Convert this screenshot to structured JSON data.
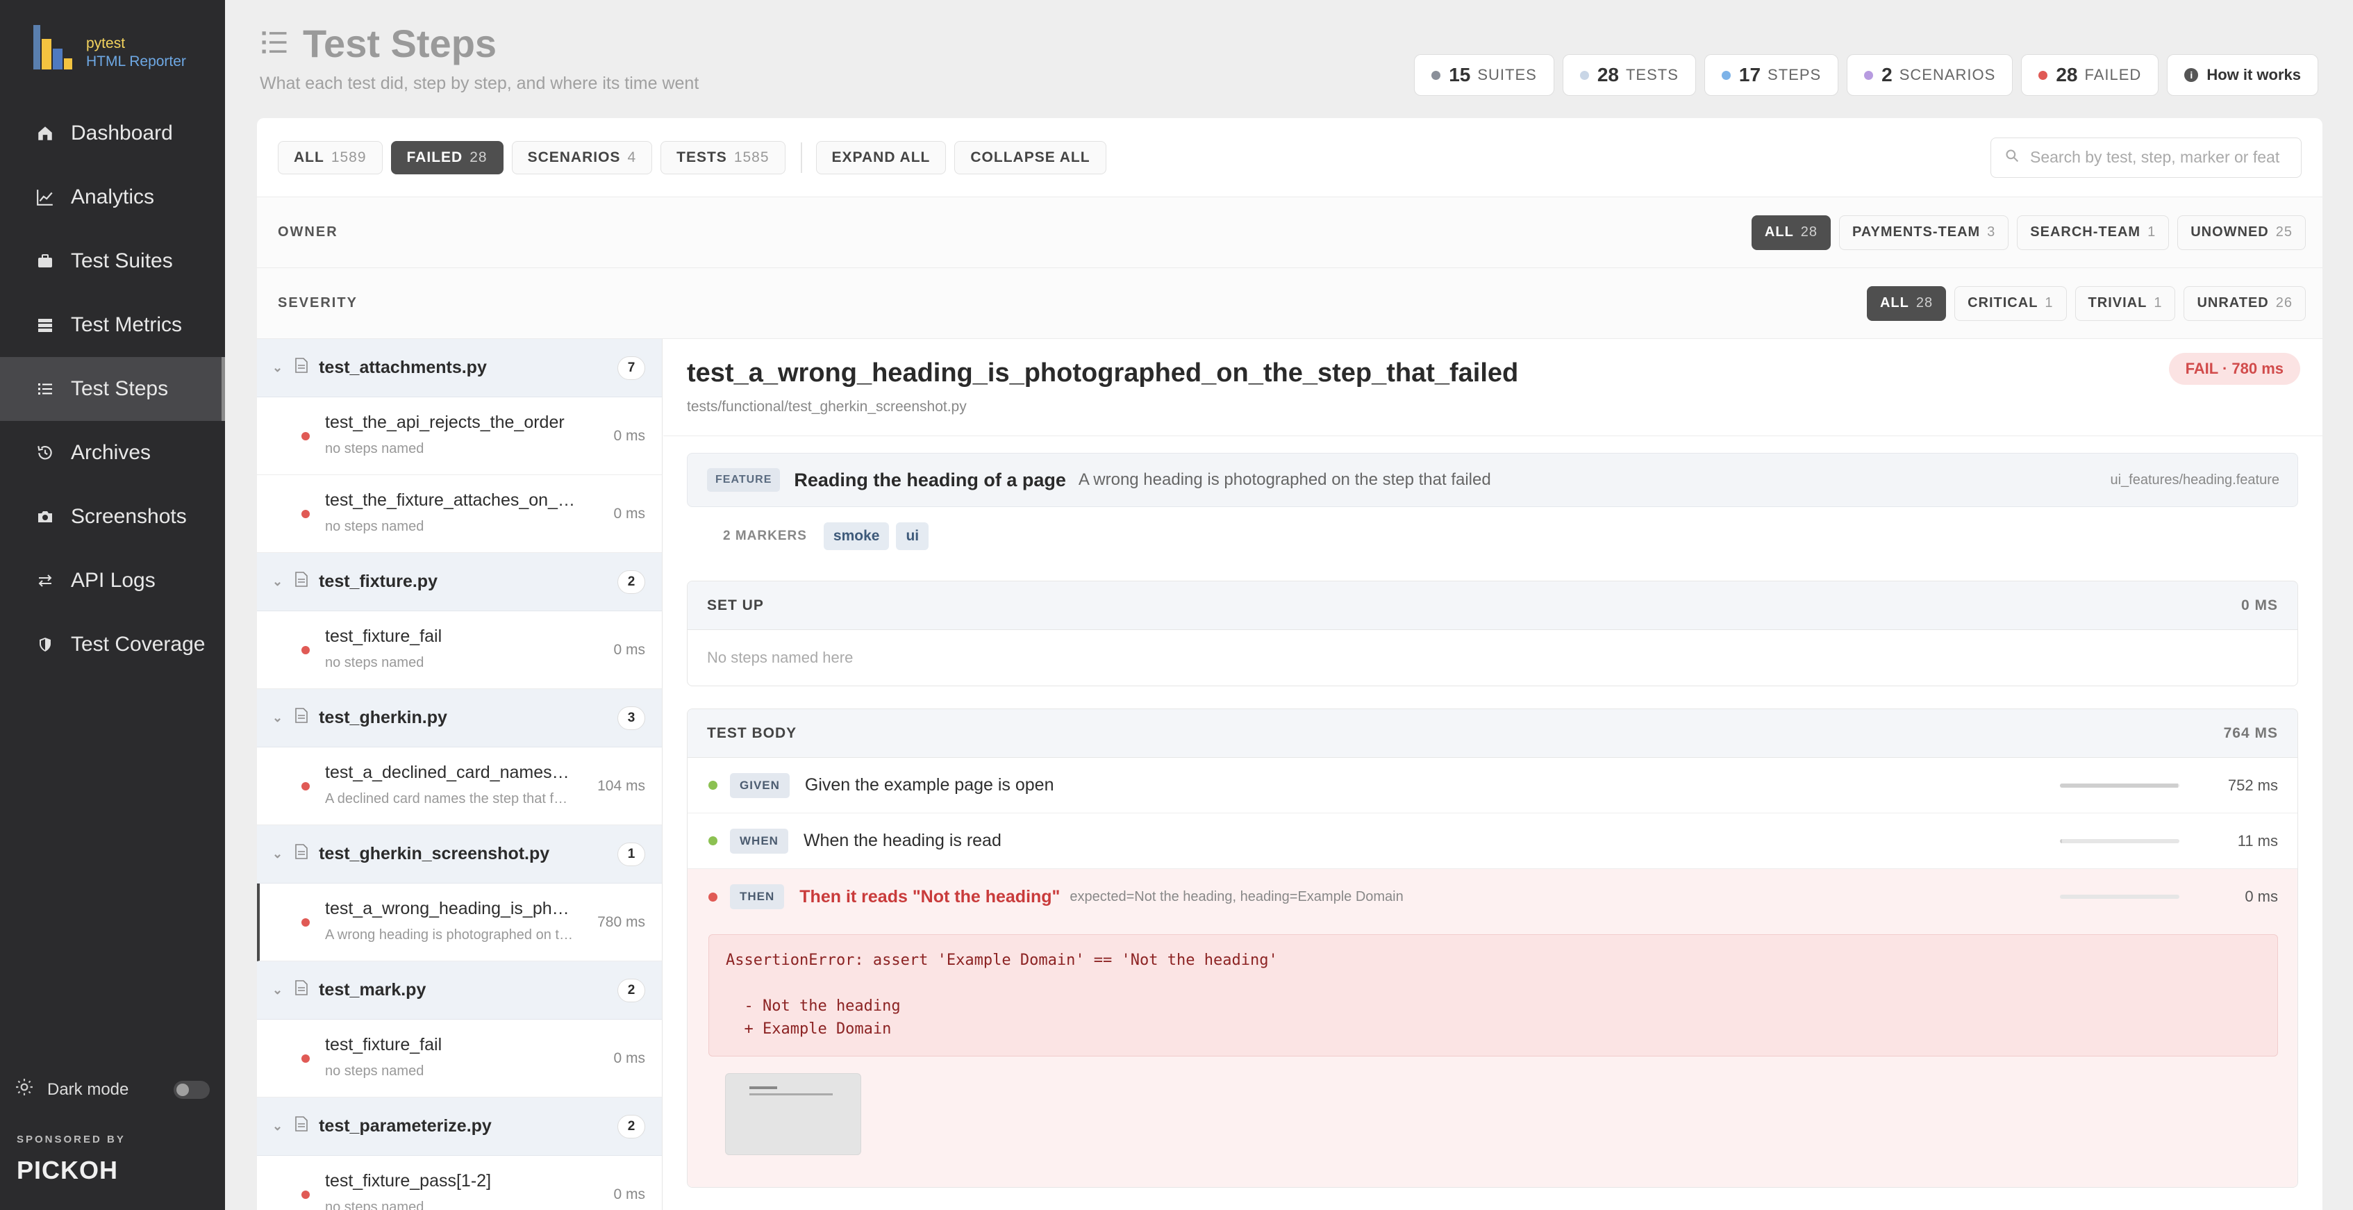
{
  "brand": {
    "line1": "pytest",
    "line2": "HTML Reporter"
  },
  "nav": [
    {
      "label": "Dashboard",
      "icon": "home-icon"
    },
    {
      "label": "Analytics",
      "icon": "line-chart-icon"
    },
    {
      "label": "Test Suites",
      "icon": "briefcase-icon"
    },
    {
      "label": "Test Metrics",
      "icon": "server-icon"
    },
    {
      "label": "Test Steps",
      "icon": "list-icon",
      "active": true
    },
    {
      "label": "Archives",
      "icon": "history-icon"
    },
    {
      "label": "Screenshots",
      "icon": "camera-icon"
    },
    {
      "label": "API Logs",
      "icon": "arrows-icon"
    },
    {
      "label": "Test Coverage",
      "icon": "shield-icon"
    }
  ],
  "dark_mode": {
    "label": "Dark mode",
    "enabled": false
  },
  "sponsor": {
    "label": "SPONSORED BY",
    "name": "PICKOH"
  },
  "header": {
    "title": "Test Steps",
    "subtitle": "What each test did, step by step, and where its time went"
  },
  "stats": [
    {
      "count": "15",
      "label": "SUITES",
      "color": "#8a8f99"
    },
    {
      "count": "28",
      "label": "TESTS",
      "color": "#c9d6e6"
    },
    {
      "count": "17",
      "label": "STEPS",
      "color": "#7db3e8"
    },
    {
      "count": "2",
      "label": "SCENARIOS",
      "color": "#b79be0"
    },
    {
      "count": "28",
      "label": "FAILED",
      "color": "#e05a55"
    }
  ],
  "how_it_works": "How it works",
  "toolbar": {
    "filters": [
      {
        "label": "ALL",
        "count": "1589"
      },
      {
        "label": "FAILED",
        "count": "28",
        "active": true
      },
      {
        "label": "SCENARIOS",
        "count": "4"
      },
      {
        "label": "TESTS",
        "count": "1585"
      }
    ],
    "expand_all": "EXPAND ALL",
    "collapse_all": "COLLAPSE ALL",
    "search_placeholder": "Search by test, step, marker or feat"
  },
  "owner": {
    "label": "OWNER",
    "chips": [
      {
        "label": "ALL",
        "count": "28",
        "active": true
      },
      {
        "label": "PAYMENTS-TEAM",
        "count": "3"
      },
      {
        "label": "SEARCH-TEAM",
        "count": "1"
      },
      {
        "label": "UNOWNED",
        "count": "25"
      }
    ]
  },
  "severity": {
    "label": "SEVERITY",
    "chips": [
      {
        "label": "ALL",
        "count": "28",
        "active": true
      },
      {
        "label": "CRITICAL",
        "count": "1"
      },
      {
        "label": "TRIVIAL",
        "count": "1"
      },
      {
        "label": "UNRATED",
        "count": "26"
      }
    ]
  },
  "groups": [
    {
      "file": "test_attachments.py",
      "count": "7",
      "items": [
        {
          "name": "test_the_api_rejects_the_order",
          "sub": "no steps named",
          "ms": "0 ms"
        },
        {
          "name": "test_the_fixture_attaches_on_failure",
          "sub": "no steps named",
          "ms": "0 ms"
        }
      ]
    },
    {
      "file": "test_fixture.py",
      "count": "2",
      "items": [
        {
          "name": "test_fixture_fail",
          "sub": "no steps named",
          "ms": "0 ms"
        }
      ]
    },
    {
      "file": "test_gherkin.py",
      "count": "3",
      "items": [
        {
          "name": "test_a_declined_card_names_the_step_that_failed",
          "sub": "A declined card names the step that failed",
          "ms": "104 ms"
        }
      ]
    },
    {
      "file": "test_gherkin_screenshot.py",
      "count": "1",
      "items": [
        {
          "name": "test_a_wrong_heading_is_photographed_on_the_step_that_failed",
          "sub": "A wrong heading is photographed on the step that failed",
          "ms": "780 ms",
          "selected": true
        }
      ]
    },
    {
      "file": "test_mark.py",
      "count": "2",
      "items": [
        {
          "name": "test_fixture_fail",
          "sub": "no steps named",
          "ms": "0 ms"
        }
      ]
    },
    {
      "file": "test_parameterize.py",
      "count": "2",
      "items": [
        {
          "name": "test_fixture_pass[1-2]",
          "sub": "no steps named",
          "ms": "0 ms"
        }
      ]
    }
  ],
  "detail": {
    "title": "test_a_wrong_heading_is_photographed_on_the_step_that_failed",
    "path": "tests/functional/test_gherkin_screenshot.py",
    "status": "FAIL · 780 ms",
    "feature": {
      "tag": "FEATURE",
      "name": "Reading the heading of a page",
      "scenario": "A wrong heading is photographed on the step that failed",
      "file": "ui_features/heading.feature"
    },
    "markers": {
      "label": "2 MARKERS",
      "tags": [
        "smoke",
        "ui"
      ]
    },
    "setup": {
      "label": "SET UP",
      "duration": "0 MS",
      "empty": "No steps named here"
    },
    "body": {
      "label": "TEST BODY",
      "duration": "764 MS",
      "steps": [
        {
          "keyword": "GIVEN",
          "text": "Given the example page is open",
          "args": "",
          "ms": "752 ms",
          "fraction": 0.99,
          "status": "passed"
        },
        {
          "keyword": "WHEN",
          "text": "When the heading is read",
          "args": "",
          "ms": "11 ms",
          "fraction": 0.015,
          "status": "passed"
        },
        {
          "keyword": "THEN",
          "text": "Then it reads \"Not the heading\"",
          "args": "expected=Not the heading, heading=Example Domain",
          "ms": "0 ms",
          "fraction": 0,
          "status": "failed"
        }
      ],
      "error": "AssertionError: assert 'Example Domain' == 'Not the heading'\n\n  - Not the heading\n  + Example Domain"
    }
  },
  "colors": {
    "pass": "#8cc152",
    "fail": "#e05a55",
    "accent": "#4f4f4f"
  }
}
